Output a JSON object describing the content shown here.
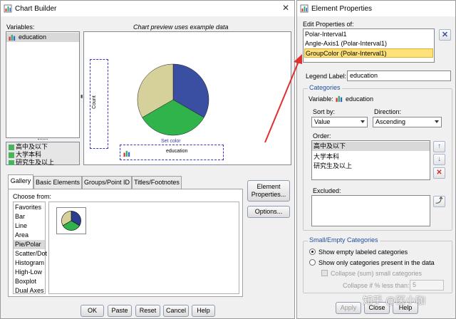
{
  "chart_builder": {
    "title": "Chart Builder",
    "variables_label": "Variables:",
    "variables": [
      {
        "name": "education"
      }
    ],
    "value_items": [
      "高中及以下",
      "大学本科",
      "研究生及以上"
    ],
    "preview_caption": "Chart preview uses example data",
    "y_axis_label": "Count",
    "set_color_label": "Set color",
    "drop_zone_label": "education",
    "tabs": [
      "Gallery",
      "Basic Elements",
      "Groups/Point ID",
      "Titles/Footnotes"
    ],
    "choose_from_label": "Choose from:",
    "chart_types": [
      "Favorites",
      "Bar",
      "Line",
      "Area",
      "Pie/Polar",
      "Scatter/Dot",
      "Histogram",
      "High-Low",
      "Boxplot",
      "Dual Axes"
    ],
    "selected_chart_type": "Pie/Polar",
    "element_properties_button": "Element\nProperties...",
    "options_button": "Options...",
    "footer_buttons": [
      "OK",
      "Paste",
      "Reset",
      "Cancel",
      "Help"
    ]
  },
  "element_properties": {
    "title": "Element Properties",
    "edit_properties_label": "Edit Properties of:",
    "edit_items": [
      "Polar-Interval1",
      "Angle-Axis1 (Polar-Interval1)",
      "GroupColor (Polar-Interval1)"
    ],
    "selected_edit_item": "GroupColor (Polar-Interval1)",
    "legend_label_label": "Legend Label:",
    "legend_label_value": "education",
    "categories_title": "Categories",
    "variable_label": "Variable:",
    "variable_value": "education",
    "sort_by_label": "Sort by:",
    "sort_by_value": "Value",
    "direction_label": "Direction:",
    "direction_value": "Ascending",
    "order_label": "Order:",
    "order_items": [
      "高中及以下",
      "大学本科",
      "研究生及以上"
    ],
    "excluded_label": "Excluded:",
    "small_empty_title": "Small/Empty Categories",
    "radio_show_empty": "Show empty labeled categories",
    "radio_show_only": "Show only categories present in the data",
    "collapse_label": "Collapse (sum) small categories",
    "collapse_if_label": "Collapse if % less than:",
    "collapse_if_value": "5",
    "footer_buttons": [
      "Apply",
      "Close",
      "Help"
    ]
  },
  "watermark": "知乎 @医小咖",
  "colors": {
    "pie_blue": "#3a4fa2",
    "pie_green": "#2fb34a",
    "pie_tan": "#d6d09a",
    "selection_yellow": "#ffe17a",
    "arrow_red": "#e03030",
    "group_title_blue": "#1f4e9c"
  }
}
